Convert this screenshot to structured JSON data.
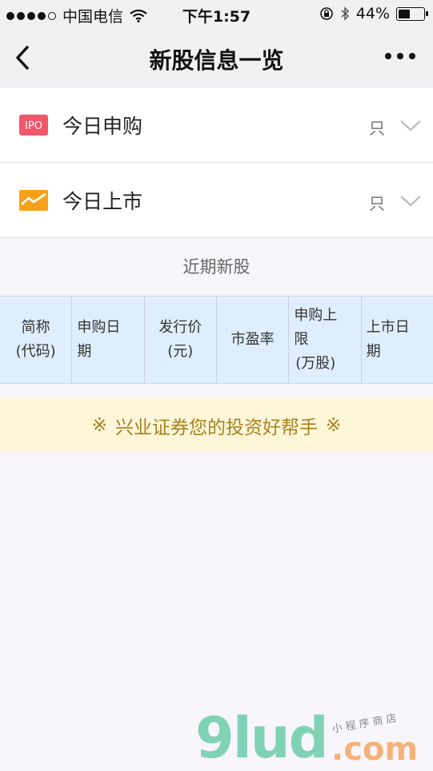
{
  "status_bar": {
    "carrier": "中国电信",
    "time": "下午1:57",
    "battery": "44%",
    "battery_level": 0.44
  },
  "nav": {
    "title": "新股信息一览",
    "icons": {
      "back": "back-arrow-icon",
      "more": "more-dots-icon"
    }
  },
  "rows": [
    {
      "label": "今日申购",
      "unit": "只",
      "icon": "ipo-icon",
      "icon_text": "IPO",
      "icon_color": "#f2566b"
    },
    {
      "label": "今日上市",
      "unit": "只",
      "icon": "market-mail-icon",
      "icon_color": "#f7a11a"
    }
  ],
  "section": {
    "title": "近期新股"
  },
  "table": {
    "headers": [
      {
        "lines": [
          "简称",
          "(代码)"
        ]
      },
      {
        "lines": [
          "申购日",
          "期"
        ]
      },
      {
        "lines": [
          "发行价",
          "(元)"
        ]
      },
      {
        "lines": [
          "市盈率"
        ]
      },
      {
        "lines": [
          "申购上",
          "限",
          "(万股)"
        ]
      },
      {
        "lines": [
          "上市日",
          "期"
        ]
      }
    ]
  },
  "banner": {
    "mark": "※",
    "text": "兴业证券您的投资好帮手"
  },
  "watermark": {
    "big": "9lud",
    "com": ".com",
    "small": "小 程 序 商 店"
  },
  "colors": {
    "header_bg": "#dfeefc",
    "banner_bg": "#fef6d8",
    "banner_text": "#a8821f"
  }
}
